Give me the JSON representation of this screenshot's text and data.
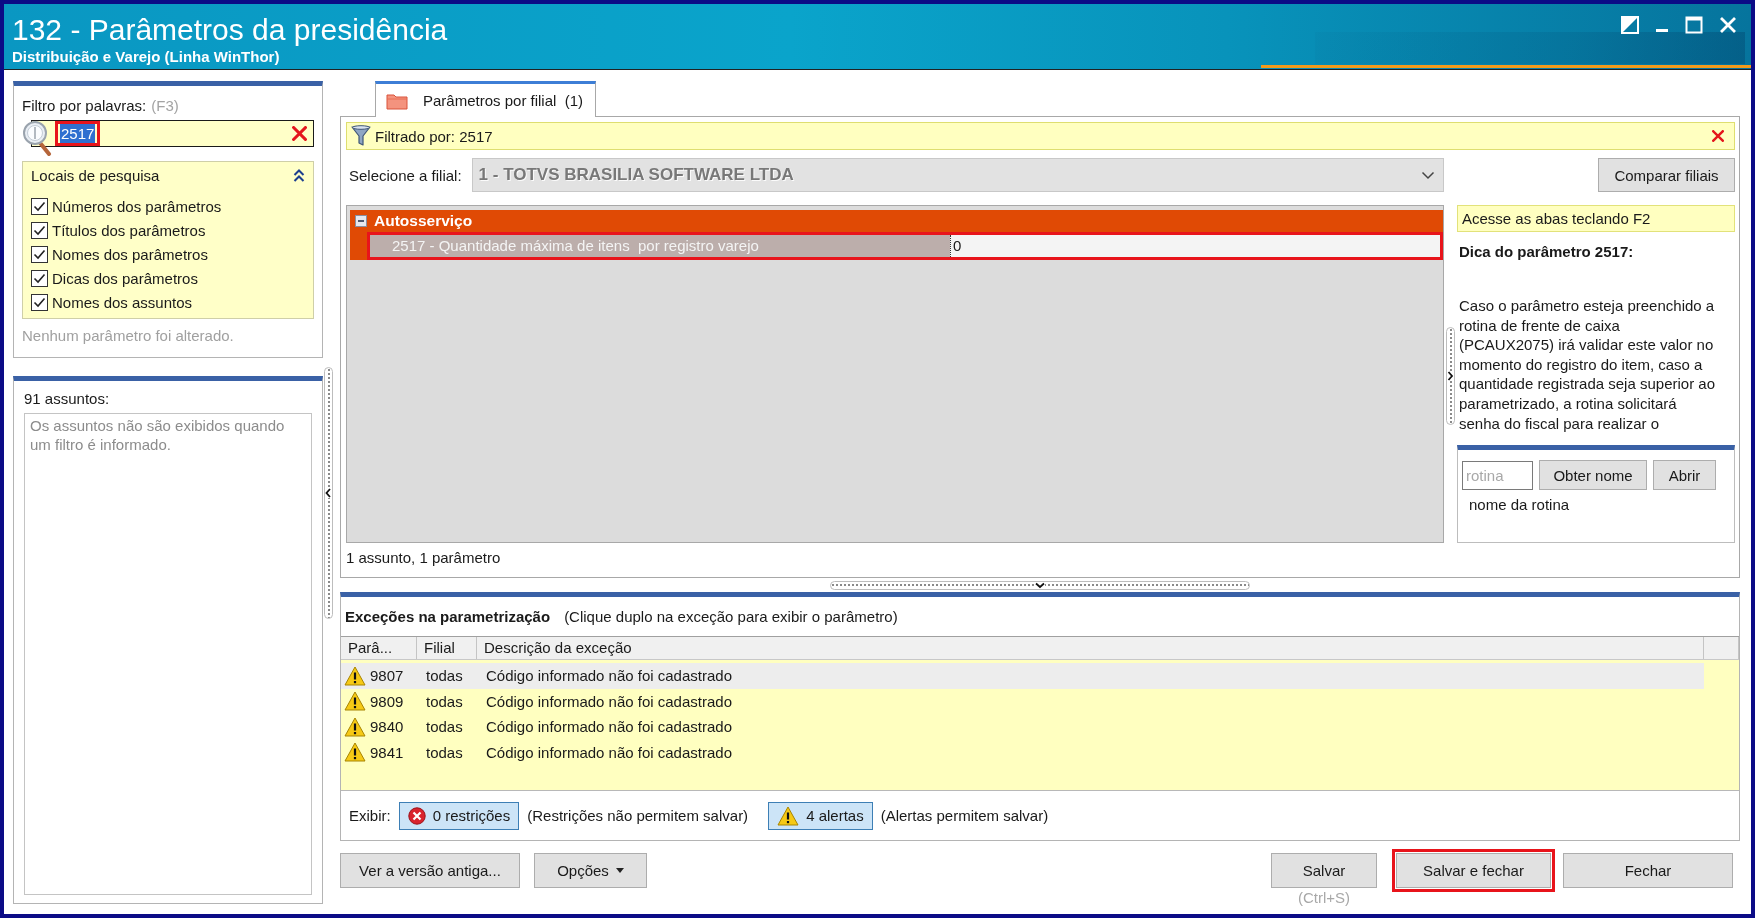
{
  "window": {
    "title": "132 - Parâmetros da presidência",
    "subtitle": "Distribuição e Varejo (Linha WinThor)"
  },
  "word_filter": {
    "label": "Filtro por palavras:",
    "shortcut": "(F3)",
    "value": "2517",
    "value_selected": true,
    "highlighted": true,
    "search_places": {
      "title": "Locais de pesquisa",
      "expanded": true,
      "options": [
        {
          "label": "Números dos parâmetros",
          "checked": true
        },
        {
          "label": "Títulos dos parâmetros",
          "checked": true
        },
        {
          "label": "Nomes dos parâmetros",
          "checked": true
        },
        {
          "label": "Dicas dos parâmetros",
          "checked": true
        },
        {
          "label": "Nomes dos assuntos",
          "checked": true
        }
      ]
    },
    "status": "Nenhum parâmetro foi alterado."
  },
  "subjects": {
    "count_label": "91 assuntos:",
    "message": "Os assuntos não são exibidos quando um filtro é informado."
  },
  "tabs": [
    {
      "label": "Parâmetros por filial  (1)",
      "selected": true
    }
  ],
  "filter_bar": {
    "text": "Filtrado por: 2517"
  },
  "branch": {
    "label": "Selecione a filial:",
    "value": "1 - TOTVS BRASILIA SOFTWARE LTDA",
    "disabled": true
  },
  "compare_button": {
    "label": "Comparar filiais"
  },
  "tree": [
    {
      "name": "Autosserviço",
      "expanded": true,
      "children": [
        {
          "name": "2517 - Quantidade máxima de itens  por registro varejo",
          "value": "0",
          "highlighted": true
        }
      ]
    }
  ],
  "tree_summary": "1 assunto, 1 parâmetro",
  "hint": {
    "notice": "Acesse as abas teclando F2",
    "title": "Dica do parâmetro 2517:",
    "text": "Caso o parâmetro esteja preenchido a rotina de frente de caixa (PCAUX2075) irá validar este valor no momento do registro do item, caso a quantidade registrada seja superior ao parametrizado, a rotina solicitará senha do fiscal para realizar o"
  },
  "routine": {
    "placeholder": "rotina",
    "buttons": [
      "Obter nome",
      "Abrir"
    ],
    "name_label": "nome da rotina"
  },
  "exceptions": {
    "title": "Exceções na parametrização",
    "note": "(Clique duplo na exceção para exibir o parâmetro)",
    "columns": [
      "Parâ...",
      "Filial",
      "Descrição da exceção"
    ],
    "rows": [
      {
        "parameter": "9807",
        "branch": "todas",
        "description": "Código informado não foi cadastrado",
        "selected": true
      },
      {
        "parameter": "9809",
        "branch": "todas",
        "description": "Código informado não foi cadastrado",
        "selected": false
      },
      {
        "parameter": "9840",
        "branch": "todas",
        "description": "Código informado não foi cadastrado",
        "selected": false
      },
      {
        "parameter": "9841",
        "branch": "todas",
        "description": "Código informado não foi cadastrado",
        "selected": false
      }
    ],
    "show_label": "Exibir:",
    "filters": [
      {
        "kind": "restriction",
        "label": "0 restrições",
        "pressed": true,
        "note": "(Restrições não permitem salvar)"
      },
      {
        "kind": "alert",
        "label": "4 alertas",
        "pressed": true,
        "note": "(Alertas permitem salvar)"
      }
    ]
  },
  "footer": {
    "left_buttons": [
      {
        "label": "Ver a versão antiga...",
        "menu": false
      },
      {
        "label": "Opções",
        "menu": true
      }
    ],
    "right_buttons": [
      {
        "label": "Salvar",
        "shortcut": "(Ctrl+S)",
        "highlighted": false
      },
      {
        "label": "Salvar e fechar",
        "highlighted": true
      },
      {
        "label": "Fechar",
        "highlighted": false
      }
    ]
  }
}
